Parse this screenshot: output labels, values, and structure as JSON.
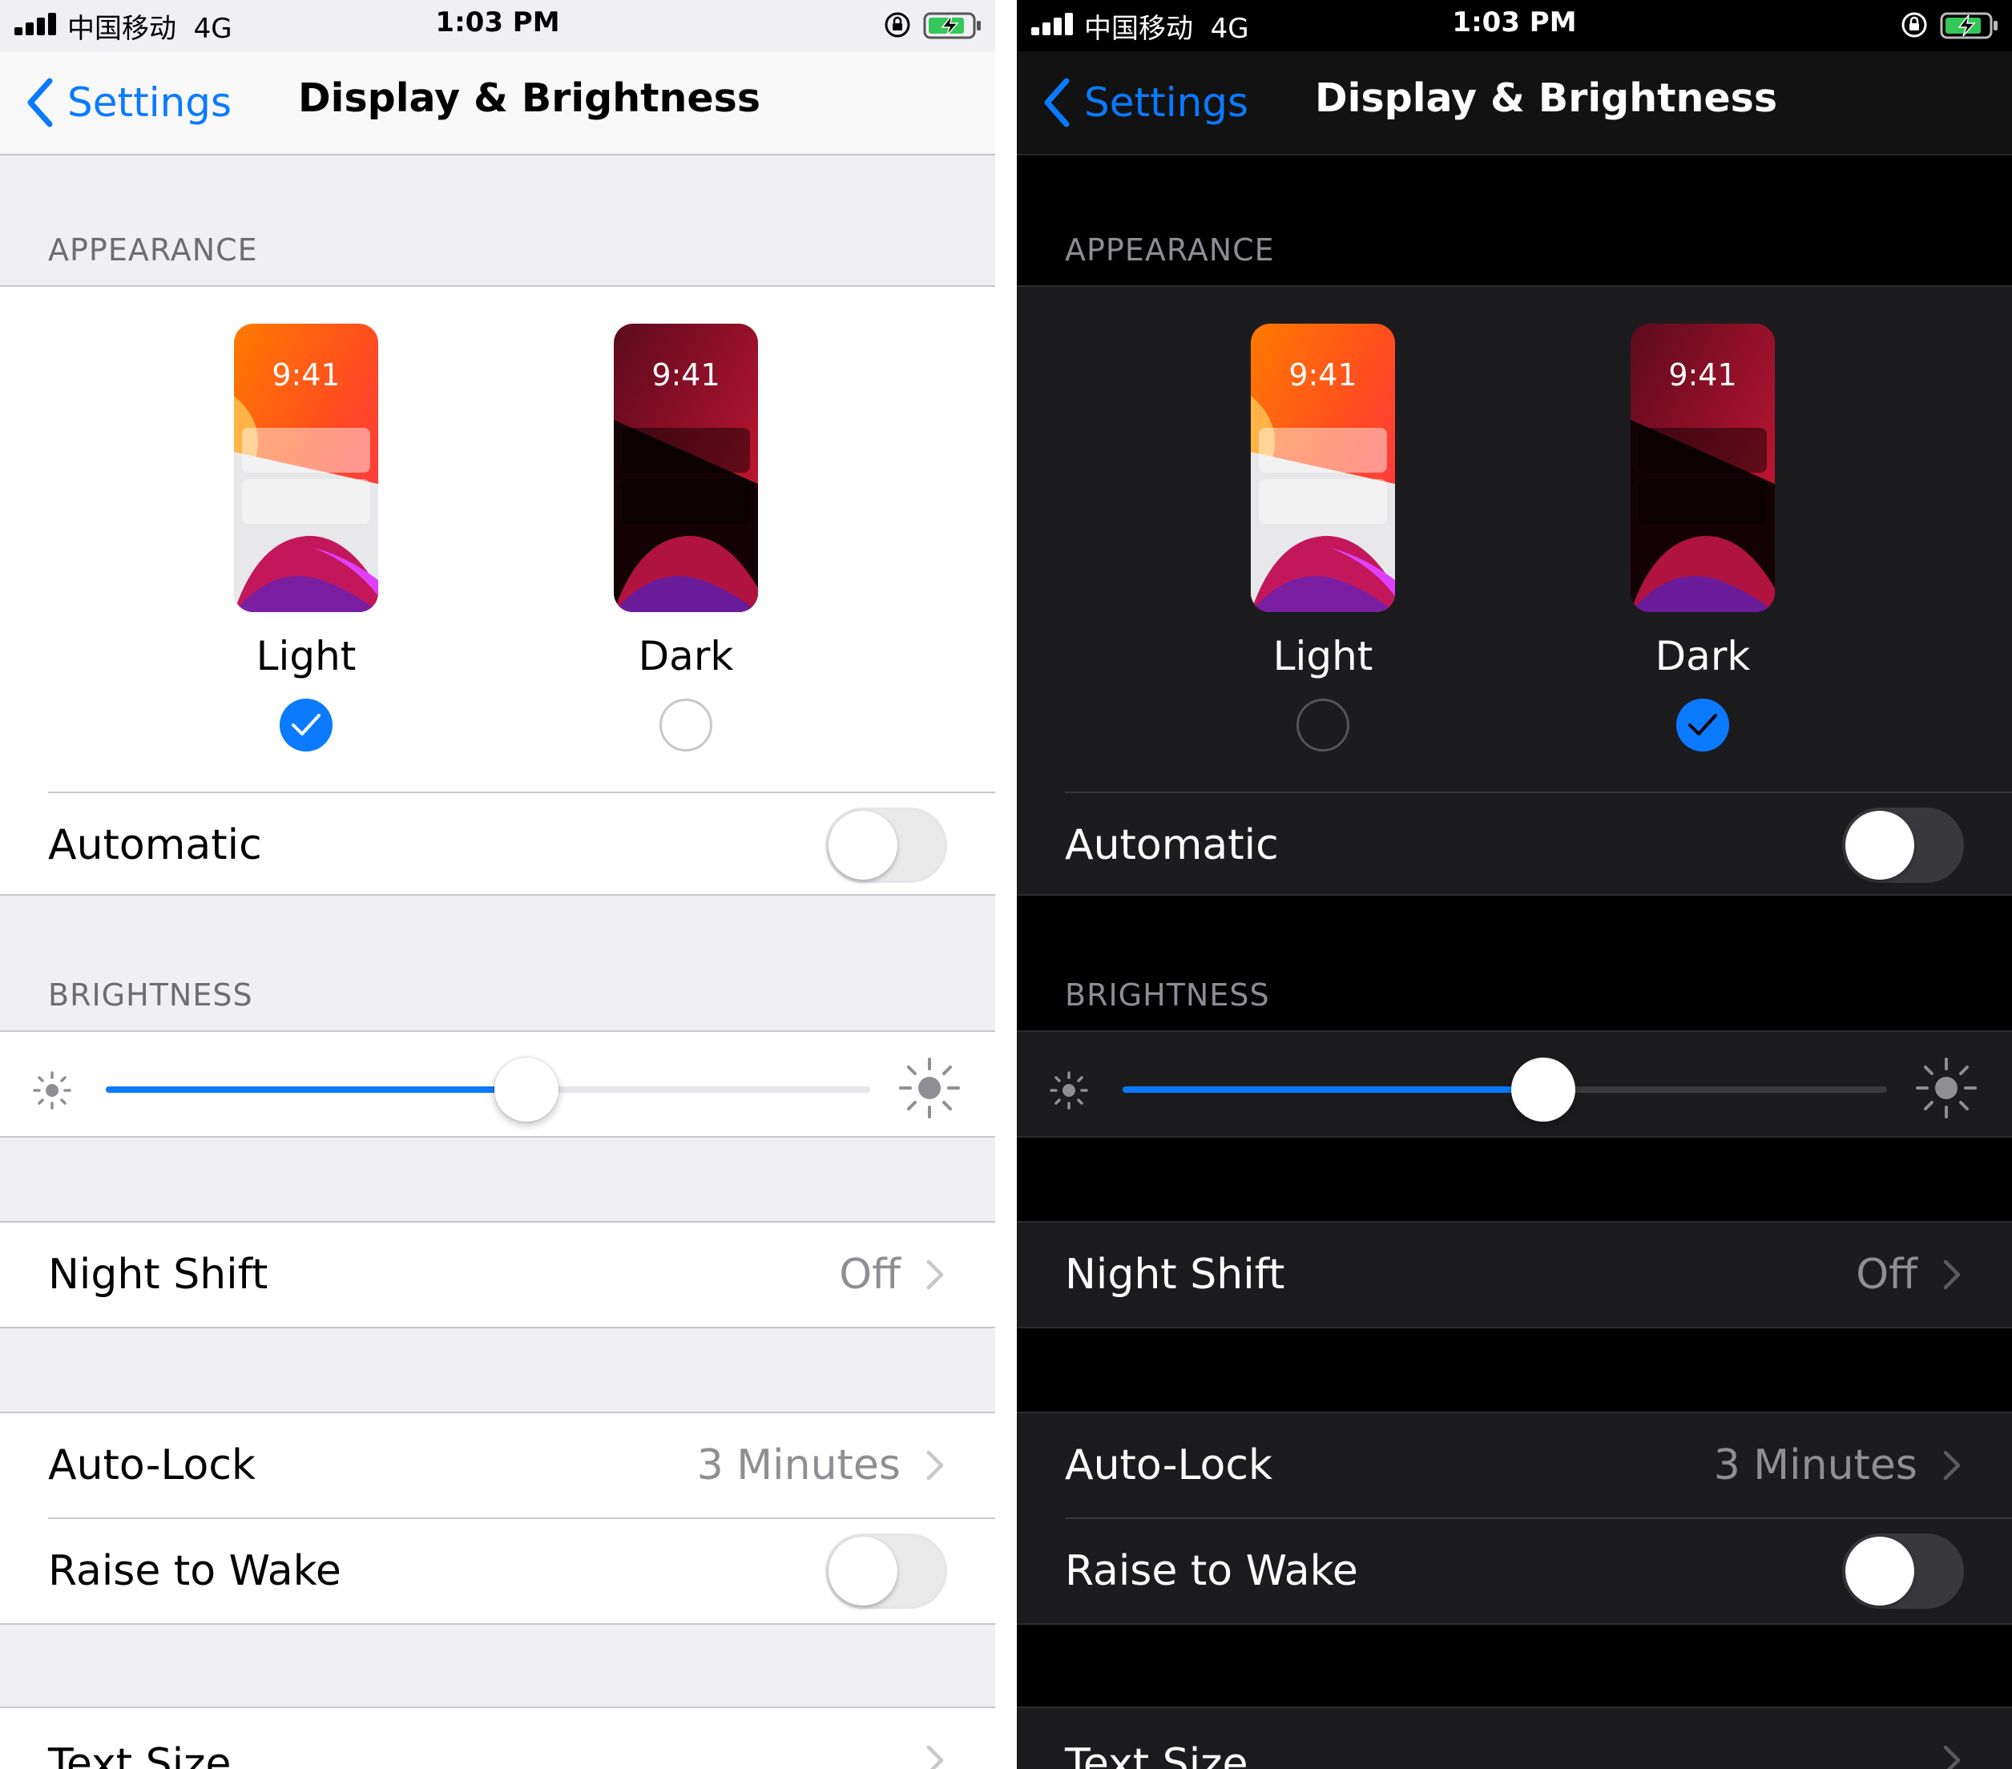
{
  "status_bar": {
    "carrier": "中国移动",
    "network": "4G",
    "time": "1:03 PM"
  },
  "nav": {
    "back_label": "Settings",
    "title": "Display & Brightness"
  },
  "appearance": {
    "header": "APPEARANCE",
    "preview_time": "9:41",
    "light_label": "Light",
    "dark_label": "Dark",
    "automatic_label": "Automatic"
  },
  "brightness": {
    "header": "BRIGHTNESS",
    "level": 0.55
  },
  "rows": {
    "night_shift_label": "Night Shift",
    "night_shift_value": "Off",
    "auto_lock_label": "Auto-Lock",
    "auto_lock_value": "3 Minutes",
    "raise_to_wake_label": "Raise to Wake",
    "text_size_label": "Text Size"
  },
  "screens": [
    {
      "theme": "light",
      "selected_mode": "Light",
      "automatic_on": false,
      "raise_to_wake_on": false
    },
    {
      "theme": "dark",
      "selected_mode": "Dark",
      "automatic_on": false,
      "raise_to_wake_on": false
    }
  ],
  "colors": {
    "accent": "#0a7aff",
    "light_background": "#efeff4",
    "dark_background": "#000000"
  },
  "icons": [
    "signal-icon",
    "orientation-lock-icon",
    "battery-charging-icon",
    "back-chevron-icon",
    "checkmark-icon",
    "sun-small-icon",
    "sun-large-icon",
    "chevron-right-icon"
  ]
}
